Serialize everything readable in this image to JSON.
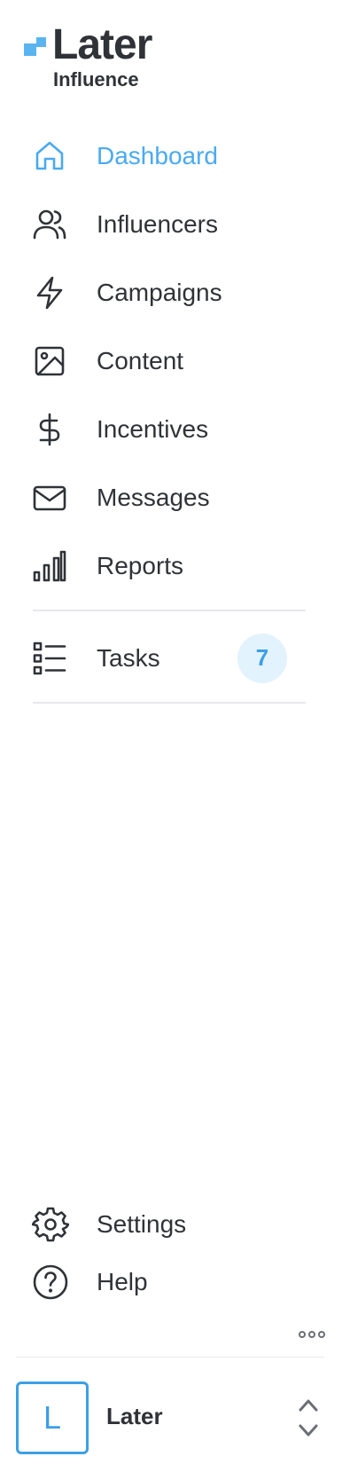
{
  "brand": {
    "name": "Later",
    "product": "Influence",
    "accent_color": "#4aaaf0"
  },
  "nav": {
    "items": [
      {
        "label": "Dashboard",
        "icon": "home-icon",
        "active": true
      },
      {
        "label": "Influencers",
        "icon": "users-icon",
        "active": false
      },
      {
        "label": "Campaigns",
        "icon": "lightning-icon",
        "active": false
      },
      {
        "label": "Content",
        "icon": "image-icon",
        "active": false
      },
      {
        "label": "Incentives",
        "icon": "dollar-icon",
        "active": false
      },
      {
        "label": "Messages",
        "icon": "mail-icon",
        "active": false
      },
      {
        "label": "Reports",
        "icon": "bar-chart-icon",
        "active": false
      }
    ],
    "tasks": {
      "label": "Tasks",
      "icon": "list-icon",
      "count": "7"
    }
  },
  "footer": {
    "settings_label": "Settings",
    "help_label": "Help"
  },
  "account": {
    "initial": "L",
    "name": "Later"
  }
}
